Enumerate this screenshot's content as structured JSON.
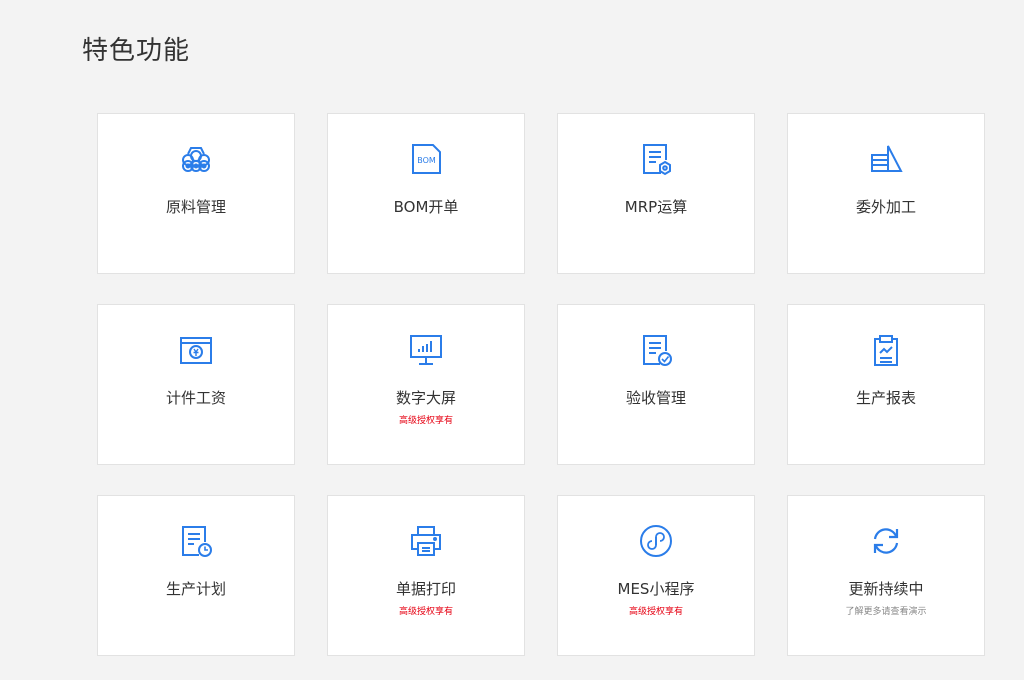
{
  "section_title": "特色功能",
  "accent_color": "#2b7de9",
  "cards": [
    {
      "label": "原料管理",
      "icon": "materials-icon",
      "note": ""
    },
    {
      "label": "BOM开单",
      "icon": "bom-file-icon",
      "icon_text": "BOM",
      "note": ""
    },
    {
      "label": "MRP运算",
      "icon": "document-gear-icon",
      "note": ""
    },
    {
      "label": "委外加工",
      "icon": "outsourcing-icon",
      "note": ""
    },
    {
      "label": "计件工资",
      "icon": "wage-icon",
      "note": ""
    },
    {
      "label": "数字大屏",
      "icon": "monitor-chart-icon",
      "note": "高级授权享有"
    },
    {
      "label": "验收管理",
      "icon": "document-check-icon",
      "note": ""
    },
    {
      "label": "生产报表",
      "icon": "clipboard-chart-icon",
      "note": ""
    },
    {
      "label": "生产计划",
      "icon": "document-clock-icon",
      "note": ""
    },
    {
      "label": "单据打印",
      "icon": "printer-icon",
      "note": "高级授权享有"
    },
    {
      "label": "MES小程序",
      "icon": "mini-program-icon",
      "note": "高级授权享有"
    },
    {
      "label": "更新持续中",
      "icon": "refresh-icon",
      "note": "了解更多请查看演示"
    }
  ]
}
